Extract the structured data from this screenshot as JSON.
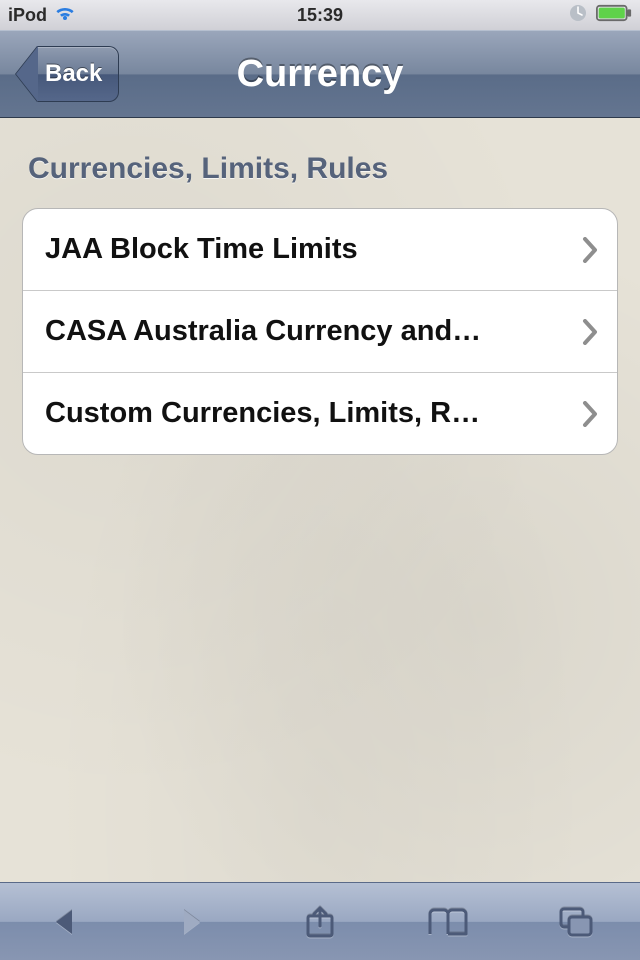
{
  "status": {
    "carrier": "iPod",
    "time": "15:39"
  },
  "nav": {
    "title": "Currency",
    "back_label": "Back"
  },
  "section": {
    "header": "Currencies, Limits, Rules",
    "items": [
      {
        "label": "JAA Block Time Limits"
      },
      {
        "label": "CASA Australia Currency and…"
      },
      {
        "label": "Custom Currencies, Limits, R…"
      }
    ]
  }
}
